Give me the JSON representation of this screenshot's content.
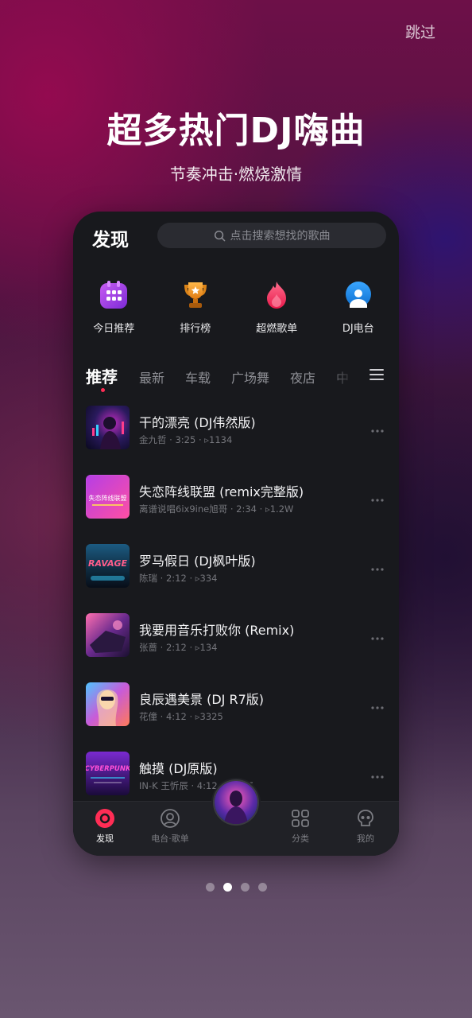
{
  "skip_label": "跳过",
  "headline": "超多热门DJ嗨曲",
  "subline": "节奏冲击·燃烧激情",
  "app": {
    "title": "发现",
    "search_placeholder": "点击搜索想找的歌曲",
    "shortcuts": [
      {
        "label": "今日推荐",
        "icon": "calendar-grid-icon",
        "color": "#a544e6"
      },
      {
        "label": "排行榜",
        "icon": "trophy-icon",
        "color": "#f29d2a"
      },
      {
        "label": "超燃歌单",
        "icon": "flame-icon",
        "color": "#ff3b6b"
      },
      {
        "label": "DJ电台",
        "icon": "radio-icon",
        "color": "#1c8dea"
      }
    ],
    "tabs": [
      "推荐",
      "最新",
      "车载",
      "广场舞",
      "夜店",
      "中"
    ],
    "songs": [
      {
        "title": "干的漂亮 (DJ伟然版)",
        "meta": "金九哲 · 3:25 · ▹1134"
      },
      {
        "title": "失恋阵线联盟 (remix完整版)",
        "meta": "离谱说唱6ix9ine旭哥 · 2:34 · ▹1.2W"
      },
      {
        "title": "罗马假日 (DJ枫叶版)",
        "meta": "陈瑞 · 2:12 · ▹334"
      },
      {
        "title": "我要用音乐打败你 (Remix)",
        "meta": "张蔷 · 2:12 · ▹134"
      },
      {
        "title": "良辰遇美景 (DJ R7版)",
        "meta": "花僮 · 4:12 · ▹3325"
      },
      {
        "title": "触摸 (DJ原版)",
        "meta": "IN-K 王忻辰 · 4:12 · ▹3325"
      }
    ],
    "cover_texts": [
      "失恋阵线联盟",
      "RAVAGE",
      "CYBERPUNK"
    ],
    "nav": [
      {
        "label": "发现",
        "icon": "disc-icon"
      },
      {
        "label": "电台·歌单",
        "icon": "radio-person-icon"
      },
      {
        "label": "分类",
        "icon": "grid-icon"
      },
      {
        "label": "我的",
        "icon": "skull-icon"
      }
    ],
    "accent": "#ff2d55"
  },
  "pager": {
    "total": 4,
    "active": 2
  }
}
